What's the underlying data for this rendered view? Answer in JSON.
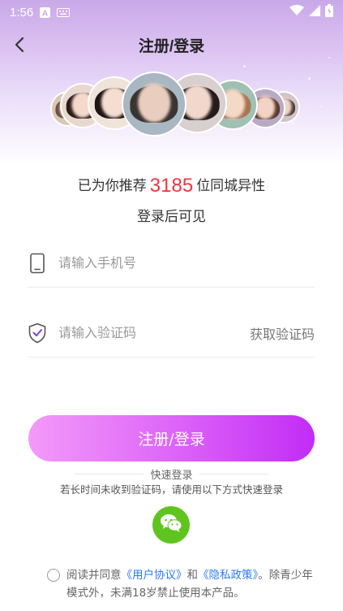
{
  "status_bar": {
    "time": "1:56"
  },
  "header": {
    "title": "注册/登录"
  },
  "recommend": {
    "prefix": "已为你推荐",
    "count": "3185",
    "suffix": "位同城异性",
    "line2": "登录后可见"
  },
  "phone_field": {
    "placeholder": "请输入手机号"
  },
  "code_field": {
    "placeholder": "请输入验证码",
    "get_code_label": "获取验证码"
  },
  "submit": {
    "label": "注册/登录"
  },
  "quick_login": {
    "label": "快速登录",
    "hint": "若长时间未收到验证码，请使用以下方式快速登录"
  },
  "agreement": {
    "t1": "阅读并同意",
    "user_link": "《用户协议》",
    "and": "和",
    "privacy_link": "《隐私政策》",
    "t2": "。除青少年模式外，未满18岁禁止使用本产品。",
    "checked": false
  },
  "colors": {
    "accent_start": "#f39af9",
    "accent_end": "#c22cf6",
    "highlight": "#f2343f",
    "link": "#2c7bf5",
    "wechat": "#5fc51e"
  },
  "icons": [
    "back-arrow-icon",
    "phone-icon",
    "shield-check-icon",
    "wechat-icon"
  ]
}
